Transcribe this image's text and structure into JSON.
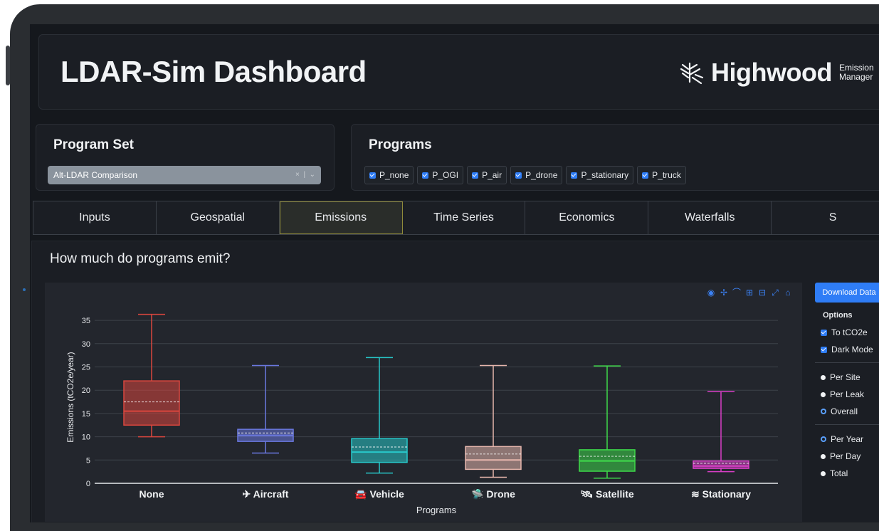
{
  "header": {
    "title": "LDAR-Sim Dashboard",
    "logo_name": "Highwood",
    "logo_sub1": "Emission",
    "logo_sub2": "Manager"
  },
  "program_set": {
    "title": "Program Set",
    "selected": "Alt-LDAR Comparison",
    "clear": "×",
    "caret": "⌄"
  },
  "programs": {
    "title": "Programs",
    "items": [
      "P_none",
      "P_OGI",
      "P_air",
      "P_drone",
      "P_stationary",
      "P_truck"
    ]
  },
  "tabs": [
    "Inputs",
    "Geospatial",
    "Emissions",
    "Time Series",
    "Economics",
    "Waterfalls",
    "S"
  ],
  "active_tab": "Emissions",
  "section": {
    "title": "How much do programs emit?"
  },
  "side": {
    "download": "Download Data",
    "options_title": "Options",
    "checks": [
      "To tCO2e",
      "Dark Mode"
    ],
    "scope": [
      "Per Site",
      "Per Leak",
      "Overall"
    ],
    "scope_selected": "Overall",
    "period": [
      "Per Year",
      "Per Day",
      "Total"
    ],
    "period_selected": "Per Year"
  },
  "chart_data": {
    "type": "box",
    "xlabel": "Programs",
    "ylabel": "Emissions (tCO2e/year)",
    "ylim": [
      0,
      37
    ],
    "yticks": [
      0,
      5,
      10,
      15,
      20,
      25,
      30,
      35
    ],
    "series": [
      {
        "name": "None",
        "icon": "",
        "color": "#d9463e",
        "min": 10,
        "q1": 12.5,
        "median": 15.5,
        "mean": 17.5,
        "q3": 22,
        "max": 36.3
      },
      {
        "name": "Aircraft",
        "icon": "✈",
        "color": "#6b78e0",
        "min": 6.5,
        "q1": 9,
        "median": 10.3,
        "mean": 10.8,
        "q3": 11.6,
        "max": 25.3
      },
      {
        "name": "Vehicle",
        "icon": "🚘",
        "color": "#28c7c9",
        "min": 2.2,
        "q1": 4.5,
        "median": 6.7,
        "mean": 7.8,
        "q3": 9.6,
        "max": 27
      },
      {
        "name": "Drone",
        "icon": "🛸",
        "color": "#e6b6ad",
        "min": 1.3,
        "q1": 3,
        "median": 5,
        "mean": 6.3,
        "q3": 7.9,
        "max": 25.3
      },
      {
        "name": "Satellite",
        "icon": "🛰",
        "color": "#3ed94a",
        "min": 1.1,
        "q1": 2.6,
        "median": 4.8,
        "mean": 5.8,
        "q3": 7.2,
        "max": 25.2
      },
      {
        "name": "Stationary",
        "icon": "≋",
        "color": "#d93fc7",
        "min": 2.5,
        "q1": 3.2,
        "median": 3.7,
        "mean": 4.3,
        "q3": 4.8,
        "max": 19.7
      }
    ]
  }
}
